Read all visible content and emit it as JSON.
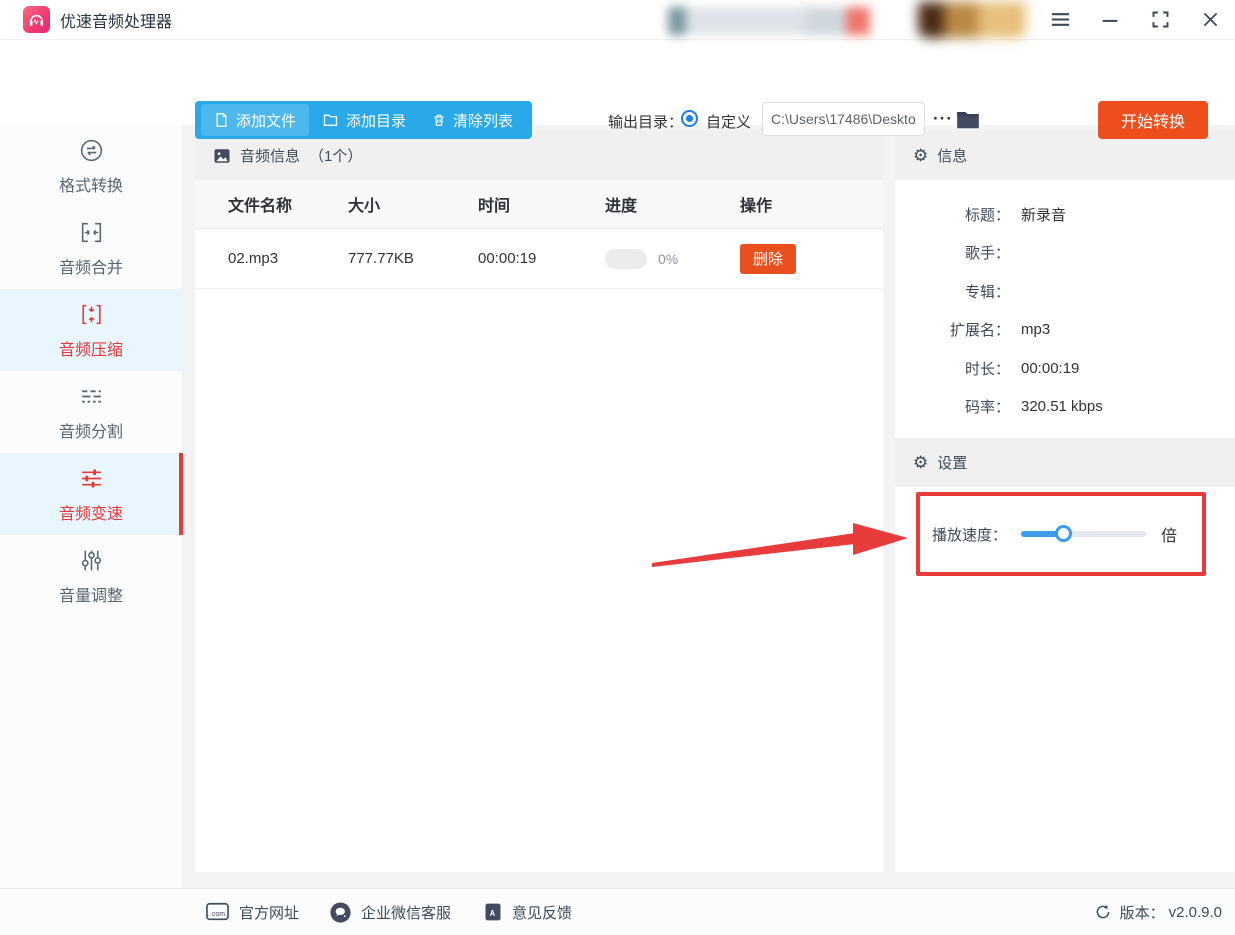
{
  "app": {
    "title": "优速音频处理器"
  },
  "toolbar": {
    "add_file": "添加文件",
    "add_folder": "添加目录",
    "clear_list": "清除列表",
    "output_dir_label": "输出目录：",
    "custom_option": "自定义",
    "path_value": "C:\\Users\\17486\\Deskto",
    "more_button": "···",
    "start_button": "开始转换"
  },
  "sidebar": {
    "items": [
      {
        "label": "格式转换",
        "icon": "format-convert-icon",
        "active": false
      },
      {
        "label": "音频合并",
        "icon": "audio-merge-icon",
        "active": false
      },
      {
        "label": "音频压缩",
        "icon": "audio-compress-icon",
        "active": true
      },
      {
        "label": "音频分割",
        "icon": "audio-split-icon",
        "active": false
      },
      {
        "label": "音频变速",
        "icon": "audio-speed-icon",
        "active": true
      },
      {
        "label": "音量调整",
        "icon": "volume-adjust-icon",
        "active": false
      }
    ]
  },
  "table": {
    "section_title": "音频信息",
    "count": "（1个）",
    "headers": [
      "文件名称",
      "大小",
      "时间",
      "进度",
      "操作"
    ],
    "rows": [
      {
        "file_name": "02.mp3",
        "size": "777.77KB",
        "time": "00:00:19",
        "progress_percent": "0%",
        "action": "删除"
      }
    ]
  },
  "info_panel": {
    "title": "信息",
    "fields": [
      {
        "label": "标题：",
        "value": "新录音"
      },
      {
        "label": "歌手：",
        "value": ""
      },
      {
        "label": "专辑：",
        "value": ""
      },
      {
        "label": "扩展名：",
        "value": "mp3"
      },
      {
        "label": "时长：",
        "value": "00:00:19"
      },
      {
        "label": "码率：",
        "value": "320.51 kbps"
      }
    ]
  },
  "settings_panel": {
    "title": "设置",
    "speed_label": "播放速度：",
    "speed_unit": "倍",
    "slider_value_fraction": 0.335
  },
  "footer": {
    "website": "官方网址",
    "website_icon_text": ".com",
    "wechat_support": "企业微信客服",
    "feedback": "意见反馈",
    "version_label": "版本：",
    "version": "v2.0.9.0"
  },
  "colors": {
    "toolbar_blue": "#29a9ea",
    "action_orange": "#ee4e1c",
    "sidebar_active_red": "#e23c3c",
    "sidebar_active_bg": "#e9f6fd",
    "slider_blue": "#3d9be9",
    "annotation_red": "#e83b3b"
  }
}
